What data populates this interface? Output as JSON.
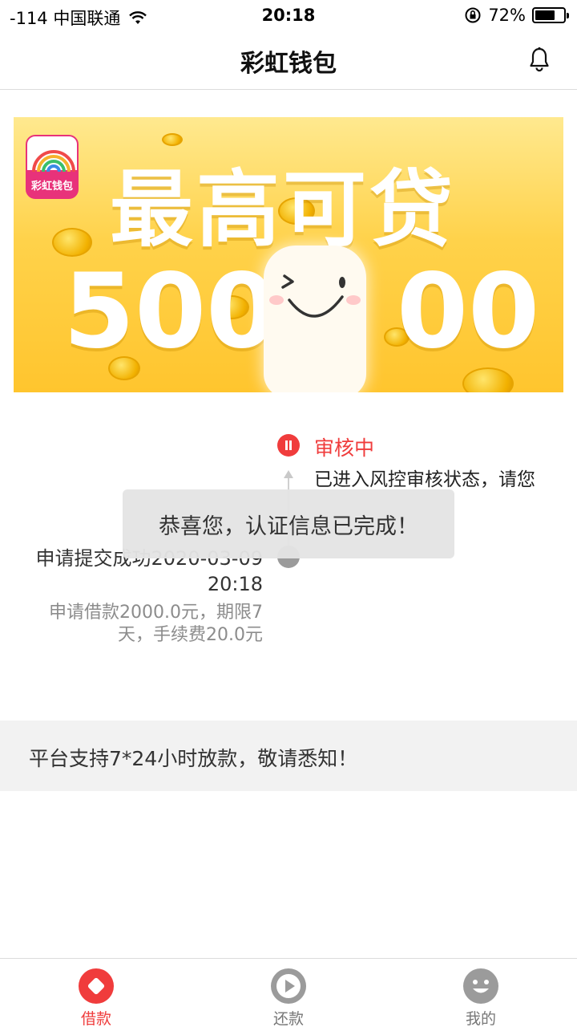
{
  "status_bar": {
    "carrier": "-114 中国联通",
    "time": "20:18",
    "battery": "72%",
    "battery_level": 0.72
  },
  "nav": {
    "title": "彩虹钱包"
  },
  "banner": {
    "logo_text": "彩虹钱包",
    "headline": "最高可贷",
    "amount_left": "500",
    "amount_right": "00"
  },
  "timeline": {
    "status_title": "审核中",
    "status_desc": "已进入风控审核状态，请您",
    "submit_title": "申请提交成功2020-03-09 20:18",
    "submit_desc": "申请借款2000.0元，期限7天，手续费20.0元"
  },
  "toast": {
    "text": "恭喜您，认证信息已完成！"
  },
  "notice": {
    "text": "平台支持7*24小时放款，敬请悉知！"
  },
  "tabs": [
    {
      "label": "借款",
      "icon": "borrow-icon",
      "active": true
    },
    {
      "label": "还款",
      "icon": "play-icon",
      "active": false
    },
    {
      "label": "我的",
      "icon": "smile-icon",
      "active": false
    }
  ],
  "colors": {
    "accent": "#f03c3c",
    "banner_yellow": "#ffc52e",
    "inactive_icon": "#9b9b9b"
  }
}
